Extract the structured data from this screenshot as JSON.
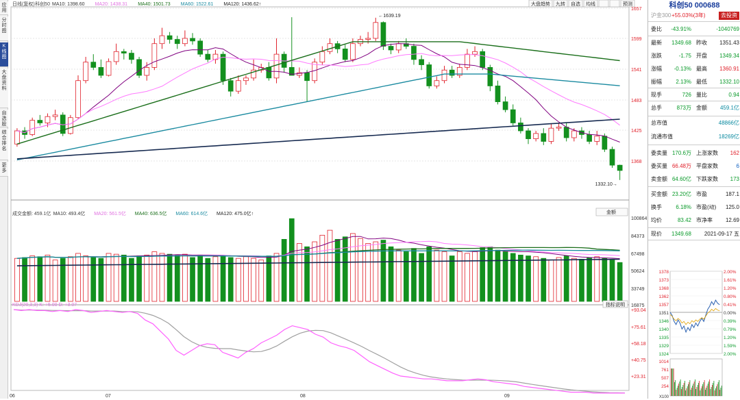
{
  "left_tabs": [
    "应用",
    "分时图",
    "K线图",
    "大盘资料",
    "自选股",
    "综合排名",
    "更多"
  ],
  "toolbar": {
    "buttons": [
      "大盘趋势",
      "九转",
      "自选",
      "均线",
      "",
      "",
      "预测"
    ]
  },
  "kline": {
    "legend": [
      {
        "text": "日线(复权)",
        "color": "#444"
      },
      {
        "text": "科创50",
        "color": "#444"
      },
      {
        "text": "MA10: 1398.60",
        "color": "#333"
      },
      {
        "text": "MA20: 1438.31",
        "color": "#e070e0"
      },
      {
        "text": "MA40: 1501.73",
        "color": "#1a6e1a"
      },
      {
        "text": "MA60: 1522.61",
        "color": "#1a8aa0"
      },
      {
        "text": "MA120: 1436.62↑",
        "color": "#222"
      }
    ],
    "ylabels": [
      "1657",
      "1599",
      "1541",
      "1483",
      "1425",
      "1368"
    ],
    "high_label": "1639.19",
    "low_label": "1332.10",
    "color_up": "#e0202a",
    "color_down": "#13901e"
  },
  "volume": {
    "legend": [
      {
        "text": "成交金额: 459.1亿",
        "color": "#444"
      },
      {
        "text": "MA10: 493.4亿",
        "color": "#333"
      },
      {
        "text": "MA20: 561.5亿",
        "color": "#e070e0"
      },
      {
        "text": "MA40: 636.5亿",
        "color": "#1a6e1a"
      },
      {
        "text": "MA60: 614.6亿",
        "color": "#1a8aa0"
      },
      {
        "text": "MA120: 475.0亿↑",
        "color": "#222"
      }
    ],
    "ylabels": [
      "100864",
      "84373",
      "67498",
      "50624",
      "33749",
      "16875"
    ],
    "select": "金额"
  },
  "kdj": {
    "legend": "KDJ(20,3,3) K: +5.00 D: +3.07",
    "ylabels": [
      "+93.04",
      "+75.61",
      "+58.18",
      "+40.75",
      "+23.31"
    ],
    "button": "指标说明"
  },
  "xaxis": [
    "06",
    "07",
    "08",
    "09"
  ],
  "rp": {
    "title": "科创50 000688",
    "ref": {
      "label": "沪金300",
      "value": "+55.03%(3年)",
      "button": "去投资"
    },
    "rows1": [
      [
        {
          "t": "委比",
          "c": ""
        },
        {
          "t": "-43.91%",
          "c": "green"
        },
        {
          "t": "-1040769",
          "c": "green"
        }
      ],
      [
        {
          "t": "最新",
          "c": ""
        },
        {
          "t": "1349.68",
          "c": "green"
        },
        {
          "t": "昨收",
          "c": ""
        },
        {
          "t": "1351.43",
          "c": ""
        }
      ],
      [
        {
          "t": "涨跌",
          "c": ""
        },
        {
          "t": "-1.75",
          "c": "green"
        },
        {
          "t": "开盘",
          "c": ""
        },
        {
          "t": "1349.34",
          "c": "green"
        }
      ],
      [
        {
          "t": "涨幅",
          "c": ""
        },
        {
          "t": "-0.13%",
          "c": "green"
        },
        {
          "t": "最高",
          "c": ""
        },
        {
          "t": "1360.91",
          "c": "red"
        }
      ],
      [
        {
          "t": "振幅",
          "c": ""
        },
        {
          "t": "2.13%",
          "c": "green"
        },
        {
          "t": "最低",
          "c": ""
        },
        {
          "t": "1332.10",
          "c": "green"
        }
      ],
      [
        {
          "t": "现手",
          "c": ""
        },
        {
          "t": "726",
          "c": "green"
        },
        {
          "t": "量比",
          "c": ""
        },
        {
          "t": "0.94",
          "c": "green"
        }
      ],
      [
        {
          "t": "总手",
          "c": ""
        },
        {
          "t": "873万",
          "c": "green"
        },
        {
          "t": "金额",
          "c": ""
        },
        {
          "t": "459.1亿",
          "c": "teal"
        }
      ]
    ],
    "rows2": [
      [
        {
          "t": "总市值",
          "c": ""
        },
        {
          "t": "48866亿",
          "c": "teal"
        }
      ],
      [
        {
          "t": "流通市值",
          "c": ""
        },
        {
          "t": "18269亿",
          "c": "teal"
        }
      ]
    ],
    "rows3": [
      [
        {
          "t": "委卖量",
          "c": ""
        },
        {
          "t": "170.6万",
          "c": "green"
        },
        {
          "t": "上涨家数",
          "c": ""
        },
        {
          "t": "162",
          "c": "red"
        }
      ],
      [
        {
          "t": "委买量",
          "c": ""
        },
        {
          "t": "66.48万",
          "c": "red"
        },
        {
          "t": "平盘家数",
          "c": ""
        },
        {
          "t": "6",
          "c": "blue"
        }
      ],
      [
        {
          "t": "卖金额",
          "c": ""
        },
        {
          "t": "64.60亿",
          "c": "green"
        },
        {
          "t": "下跌家数",
          "c": ""
        },
        {
          "t": "173",
          "c": "green"
        }
      ]
    ],
    "rows4": [
      [
        {
          "t": "买金额",
          "c": ""
        },
        {
          "t": "23.20亿",
          "c": "green"
        },
        {
          "t": "市盈",
          "c": ""
        },
        {
          "t": "187.1",
          "c": ""
        }
      ],
      [
        {
          "t": "换手",
          "c": ""
        },
        {
          "t": "6.18%",
          "c": "green"
        },
        {
          "t": "市盈(动)",
          "c": ""
        },
        {
          "t": "125.0",
          "c": ""
        }
      ],
      [
        {
          "t": "均价",
          "c": ""
        },
        {
          "t": "83.42",
          "c": "green"
        },
        {
          "t": "市净率",
          "c": ""
        },
        {
          "t": "12.69",
          "c": ""
        }
      ]
    ],
    "now": {
      "label": "现价",
      "price": "1349.68",
      "date": "2021-09-17 五"
    },
    "mini": {
      "left": [
        "1378",
        "1373",
        "1368",
        "1362",
        "1357",
        "1351",
        "1346",
        "1340",
        "1335",
        "1329",
        "1324"
      ],
      "right": [
        "2.00%",
        "1.61%",
        "1.20%",
        "0.80%",
        "0.41%",
        "0.00%",
        "0.39%",
        "0.79%",
        "1.20%",
        "1.59%",
        "2.00%"
      ],
      "vol": [
        "1014",
        "761",
        "507",
        "254"
      ],
      "vol_unit": "X100"
    }
  }
}
